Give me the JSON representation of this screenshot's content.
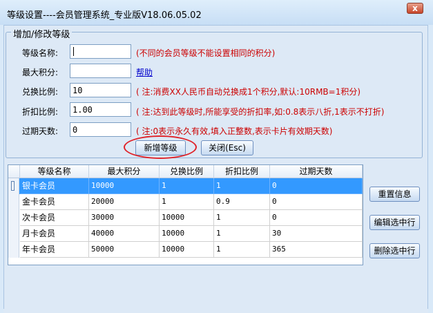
{
  "window": {
    "title": "等级设置----会员管理系统_专业版V18.06.05.02",
    "close_glyph": "x"
  },
  "form": {
    "group_title": "增加/修改等级",
    "fields": [
      {
        "label": "等级名称:",
        "value": "",
        "note": "(不同的会员等级不能设置相同的积分)"
      },
      {
        "label": "最大积分:",
        "value": "",
        "link": "帮助"
      },
      {
        "label": "兑换比例:",
        "value": "10",
        "note": "( 注:消费XX人民币自动兑换成1个积分,默认:10RMB=1积分)"
      },
      {
        "label": "折扣比例:",
        "value": "1.00",
        "note": "( 注:达到此等级时,所能享受的折扣率,如:0.8表示八折,1表示不打折)"
      },
      {
        "label": "过期天数:",
        "value": "0",
        "note": "( 注:0表示永久有效,填入正整数,表示卡片有效期天数)"
      }
    ],
    "add_button": "新增等级",
    "close_button": "关闭(Esc)"
  },
  "grid": {
    "columns": [
      "等级名称",
      "最大积分",
      "兑换比例",
      "折扣比例",
      "过期天数"
    ],
    "rows": [
      {
        "name": "银卡会员",
        "max": "10000",
        "ratio": "1",
        "discount": "1",
        "days": "0",
        "selected": true
      },
      {
        "name": "金卡会员",
        "max": "20000",
        "ratio": "1",
        "discount": "0.9",
        "days": "0"
      },
      {
        "name": "次卡会员",
        "max": "30000",
        "ratio": "10000",
        "discount": "1",
        "days": "0"
      },
      {
        "name": "月卡会员",
        "max": "40000",
        "ratio": "10000",
        "discount": "1",
        "days": "30"
      },
      {
        "name": "年卡会员",
        "max": "50000",
        "ratio": "10000",
        "discount": "1",
        "days": "365"
      }
    ]
  },
  "side_buttons": {
    "reset": "重置信息",
    "edit": "编辑选中行",
    "delete": "删除选中行"
  },
  "colors": {
    "selection": "#3399ff",
    "note": "#cc0000",
    "highlight_ring": "#e0242a"
  }
}
